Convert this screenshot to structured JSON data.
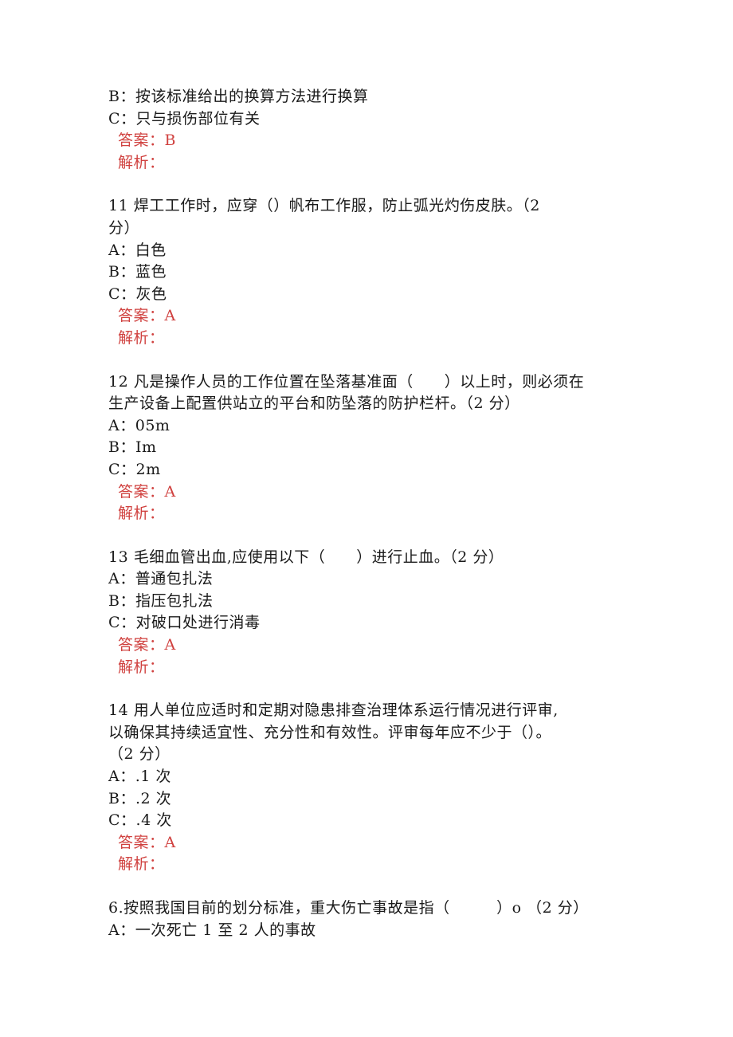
{
  "intro_block": {
    "options": [
      {
        "label": "B：",
        "text": "按该标准给出的换算方法进行换算"
      },
      {
        "label": "C：",
        "text": "只与损伤部位有关"
      }
    ],
    "answer_label": "答案：",
    "answer": "B",
    "analysis_label": "解析："
  },
  "questions": [
    {
      "stem_lines": [
        "11 焊工工作时，应穿（）帆布工作服，防止弧光灼伤皮肤。（2",
        "分）"
      ],
      "options": [
        {
          "label": "A：",
          "text": "白色"
        },
        {
          "label": "B：",
          "text": "蓝色"
        },
        {
          "label": "C：",
          "text": "灰色"
        }
      ],
      "answer_label": "答案：",
      "answer": "A",
      "analysis_label": "解析："
    },
    {
      "stem_lines": [
        "12 凡是操作人员的工作位置在坠落基准面（　　）以上时，则必须在",
        "生产设备上配置供站立的平台和防坠落的防护栏杆。（2 分）"
      ],
      "options": [
        {
          "label": "A：",
          "text": "05m"
        },
        {
          "label": "B：",
          "text": "Im"
        },
        {
          "label": "C：",
          "text": "2m"
        }
      ],
      "answer_label": "答案：",
      "answer": "A",
      "analysis_label": "解析："
    },
    {
      "stem_lines": [
        "13 毛细血管出血,应使用以下（　　）进行止血。（2 分）"
      ],
      "options": [
        {
          "label": "A：",
          "text": "普通包扎法"
        },
        {
          "label": "B：",
          "text": "指压包扎法"
        },
        {
          "label": "C：",
          "text": "对破口处进行消毒"
        }
      ],
      "answer_label": "答案：",
      "answer": "A",
      "analysis_label": "解析："
    },
    {
      "stem_lines": [
        "14 用人单位应适时和定期对隐患排查治理体系运行情况进行评审,",
        "以确保其持续适宜性、充分性和有效性。评审每年应不少于（）。",
        "（2 分）"
      ],
      "options": [
        {
          "label": "A：",
          "text": ".1 次"
        },
        {
          "label": "B：",
          "text": ".2 次"
        },
        {
          "label": "C：",
          "text": ".4 次"
        }
      ],
      "answer_label": "答案：",
      "answer": "A",
      "analysis_label": "解析："
    }
  ],
  "last_question": {
    "stem_lines": [
      "6.按照我国目前的划分标准，重大伤亡事故是指（　　　）o （2 分）"
    ],
    "options": [
      {
        "label": "A：",
        "text": "一次死亡 1 至 2 人的事故"
      }
    ]
  },
  "colors": {
    "text": "#1a1a1a",
    "answer_red": "#d0413f"
  }
}
